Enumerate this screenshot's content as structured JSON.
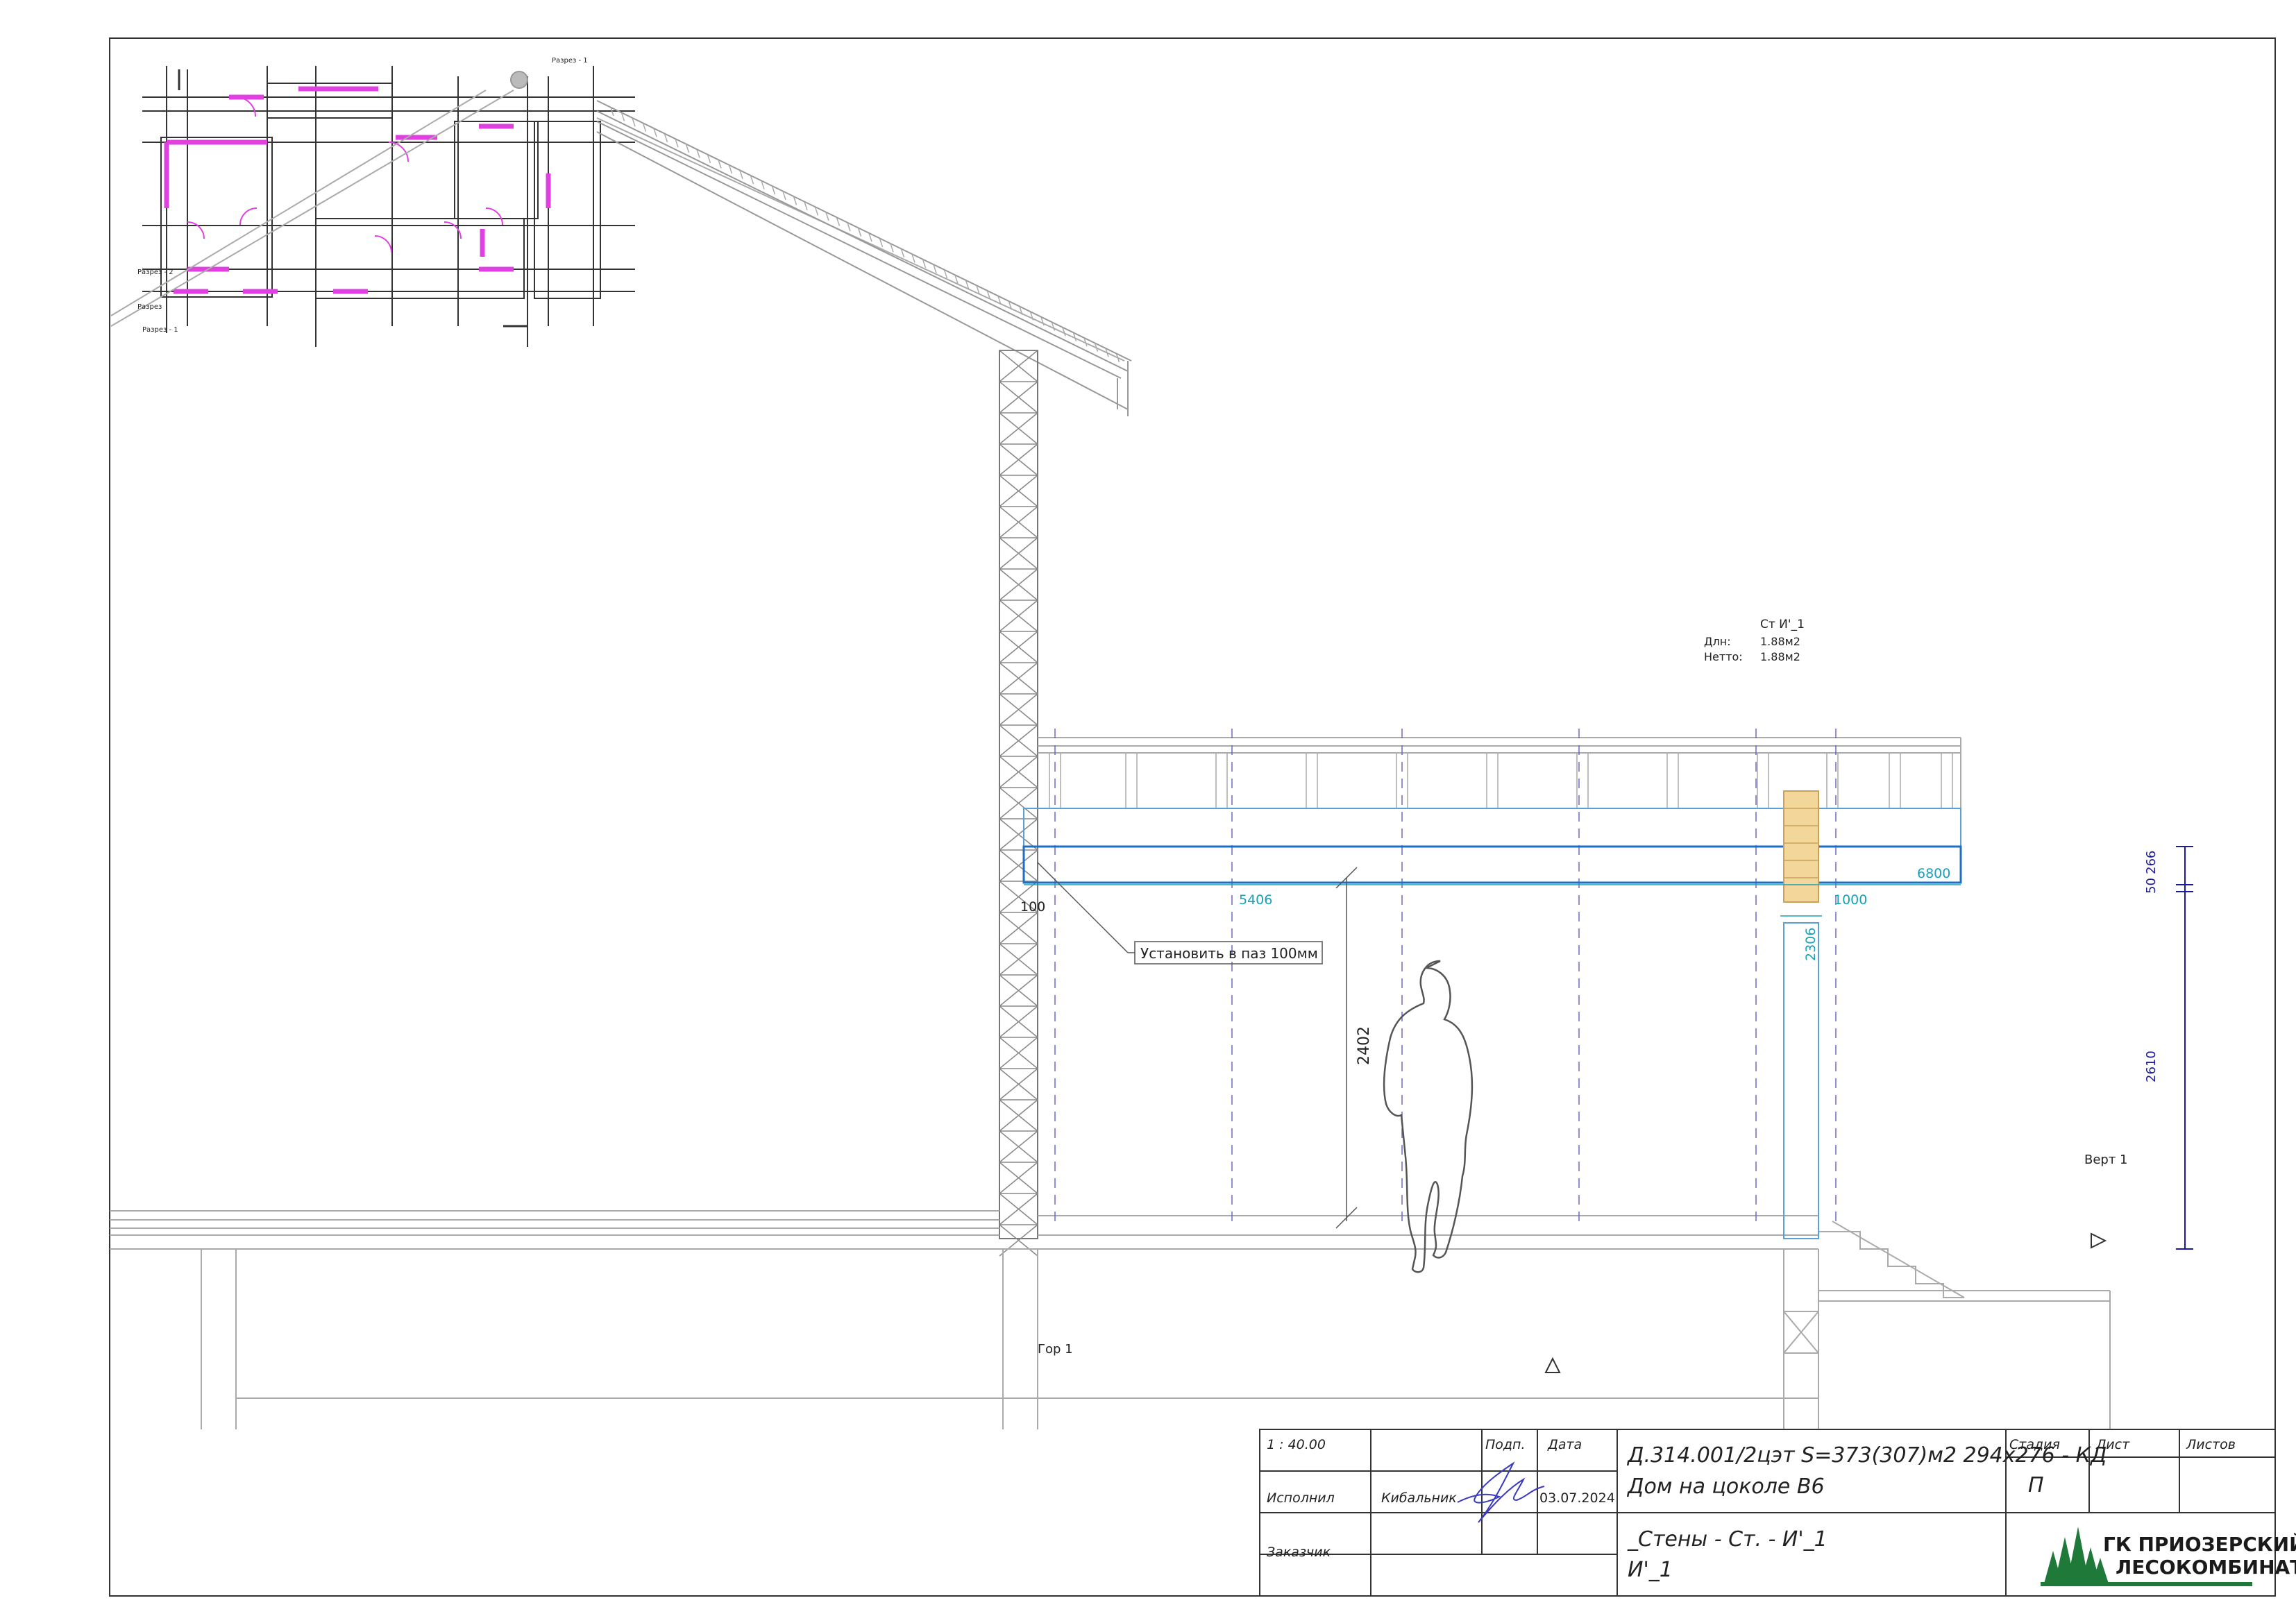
{
  "section": {
    "wall_tag": {
      "name": "Ст И'_1",
      "gross_label": "Длн:",
      "gross_value": "1.88м2",
      "net_label": "Нетто:",
      "net_value": "1.88м2"
    },
    "callout": "Установить в паз 100мм",
    "dims": {
      "beam_total": "6800",
      "beam_span": "5406",
      "beam_overhang": "1000",
      "slot_depth": "100",
      "clear_height": "2402",
      "post_height": "2306",
      "vert_top_a": "266",
      "vert_top_b": "50",
      "vert_main": "2610"
    },
    "markers": {
      "vertical": "Верт 1",
      "horizontal": "Гор 1"
    }
  },
  "plan_labels": {
    "cut_a": "Разрез - 1",
    "cut_b": "Разрез - 2",
    "cut_c": "Разрез",
    "cut_d": "Разрез - 1"
  },
  "title_block": {
    "scale": "1 : 40.00",
    "col_sign": "Подп.",
    "col_date": "Дата",
    "row_performer": "Исполнил",
    "performer_name": "Кибальник",
    "date": "03.07.2024",
    "row_customer": "Заказчик",
    "project_code": "Д.314.001/2цэт S=373(307)м2 294х276 - КД",
    "project_name": "Дом на цоколе В6",
    "sheet_title_1": "_Стены - Ст. - И'_1",
    "sheet_title_2": "И'_1",
    "col_stage": "Стадия",
    "col_sheet": "Лист",
    "col_sheets": "Листов",
    "stage": "П",
    "logo_line1": "ГК ПРИОЗЕРСКИЙ",
    "logo_line2": "ЛЕСОКОМБИНАТ"
  },
  "colors": {
    "line": "#b8b8b8",
    "dark": "#333333",
    "beam": "#1f6fc0",
    "dim_cyan": "#1aa0b8",
    "dim_blue": "#1a1a9a",
    "wall_magenta": "#e040e0",
    "wood": "#f3d79a",
    "logo_green": "#1f7a3a"
  }
}
